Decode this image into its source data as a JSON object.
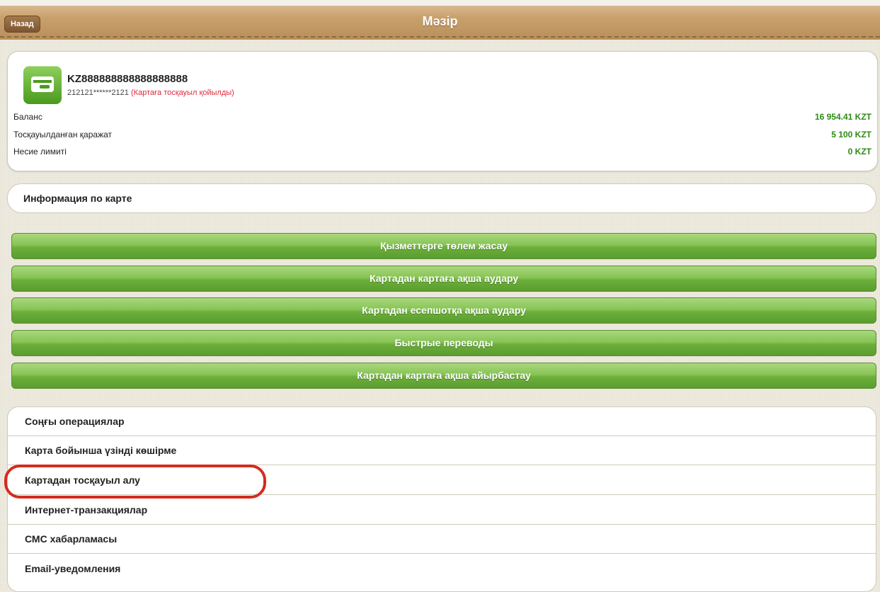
{
  "header": {
    "back_label": "Назад",
    "title": "Мәзір"
  },
  "account": {
    "number": "KZ888888888888888888",
    "card_masked": "212121******2121",
    "card_status": "(Картаға тосқауыл қойылды)",
    "rows": [
      {
        "label": "Баланс",
        "value": "16 954.41 KZT"
      },
      {
        "label": "Тосқауылданған қаражат",
        "value": "5 100 KZT"
      },
      {
        "label": "Несие лимиті",
        "value": "0 KZT"
      }
    ]
  },
  "info_link": "Информация по карте",
  "action_buttons": [
    "Қызметтерге төлем жасау",
    "Картадан картаға ақша аудару",
    "Картадан есепшотқа ақша аудару",
    "Быстрые переводы",
    "Картадан картаға ақша айырбастау"
  ],
  "menu_items": [
    "Соңғы операциялар",
    "Карта бойынша үзінді көшірме",
    "Картадан тосқауыл алу",
    "Интернет-транзакциялар",
    "СМС хабарламасы",
    "Email-уведомления"
  ],
  "colors": {
    "accent_green": "#2e8b12",
    "status_red": "#e0273a",
    "highlight_red": "#d42b1e"
  },
  "icons": {
    "card": "credit-card-icon"
  }
}
